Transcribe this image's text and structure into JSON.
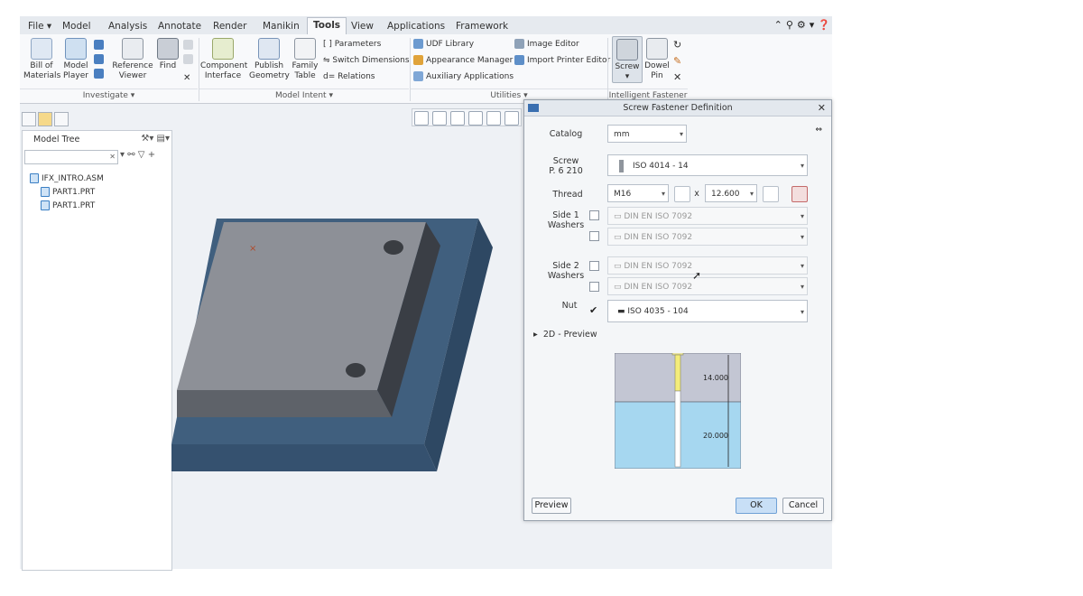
{
  "menubar": {
    "tabs": [
      "File",
      "Model",
      "Analysis",
      "Annotate",
      "Render",
      "Manikin",
      "Tools",
      "View",
      "Applications",
      "Framework"
    ],
    "active_tab": "Tools"
  },
  "ribbon": {
    "investigate": {
      "bom": "Bill of Materials",
      "model_player": "Model Player",
      "reference_viewer": "Reference Viewer",
      "find": "Find",
      "group_label": "Investigate"
    },
    "model_intent": {
      "component_interface": "Component Interface",
      "publish_geometry": "Publish Geometry",
      "family_table": "Family Table",
      "parameters": "Parameters",
      "switch_dimensions": "Switch Dimensions",
      "relations": "Relations",
      "group_label": "Model Intent"
    },
    "utilities": {
      "udf_library": "UDF Library",
      "appearance_manager": "Appearance Manager",
      "auxiliary_applications": "Auxiliary Applications",
      "image_editor": "Image Editor",
      "import_printer_editor": "Import Printer Editor",
      "group_label": "Utilities"
    },
    "intelligent_fastener": {
      "screw": "Screw",
      "dowel_pin": "Dowel Pin",
      "group_label": "Intelligent Fastener"
    }
  },
  "model_tree": {
    "title": "Model Tree",
    "items": [
      "IFX_INTRO.ASM",
      "PART1.PRT",
      "PART1.PRT"
    ]
  },
  "dialog": {
    "title": "Screw Fastener Definition",
    "catalog_label": "Catalog",
    "catalog_value": "mm",
    "screw_label": "Screw",
    "screw_sub": "P. 6 210",
    "screw_value": "ISO 4014 - 14",
    "thread_label": "Thread",
    "thread_value": "M16",
    "x_label": "x",
    "length_value": "12.600",
    "side1_label": "Side 1 Washers",
    "side1_w1": "DIN EN ISO 7092",
    "side1_w2": "DIN EN ISO 7092",
    "side2_label": "Side 2 Washers",
    "side2_w1": "DIN EN ISO 7092",
    "side2_w2": "DIN EN ISO 7092",
    "nut_label": "Nut",
    "nut_value": "ISO 4035 - 104",
    "preview_label": "2D - Preview",
    "dim_top": "14.000",
    "dim_bottom": "20.000",
    "preview_btn": "Preview",
    "ok_btn": "OK",
    "cancel_btn": "Cancel"
  },
  "colors": {
    "accent": "#3a6fb0",
    "model_base": "#3d5b7a",
    "model_plate": "#8a8d94",
    "preview_top": "#c3c6d3",
    "preview_bottom": "#a6d7f0"
  }
}
